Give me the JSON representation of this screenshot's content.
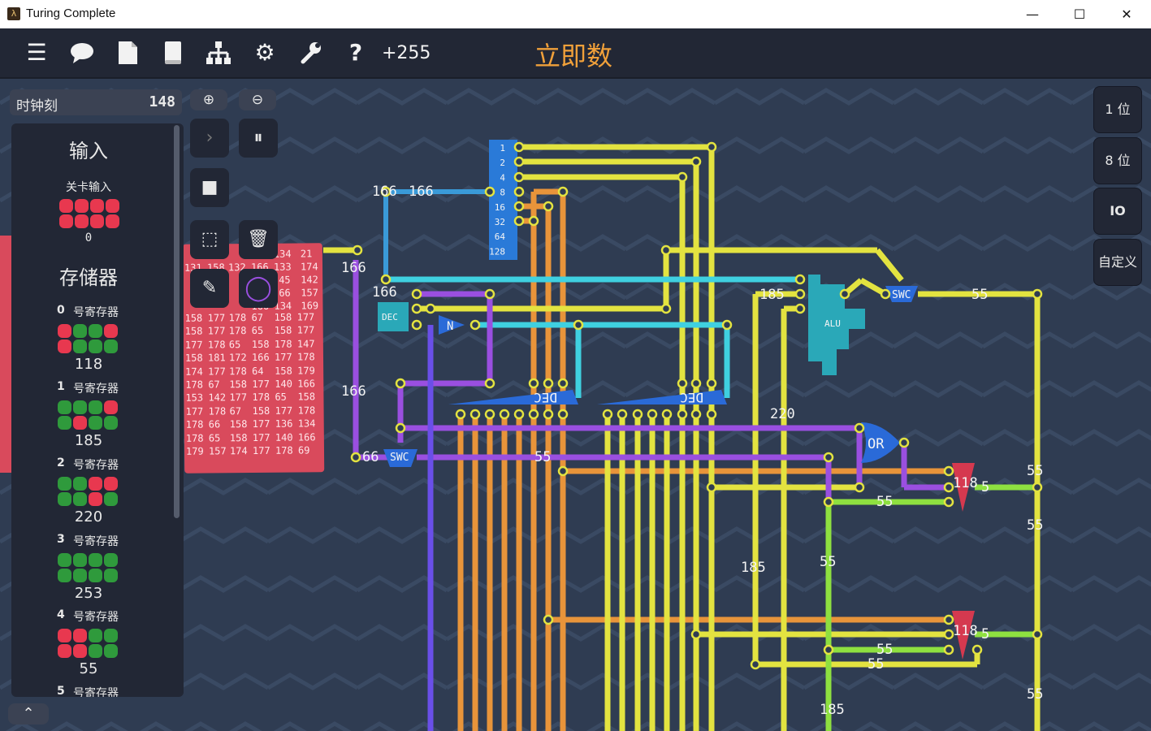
{
  "window": {
    "title": "Turing Complete",
    "controls": {
      "minimize": "—",
      "maximize": "☐",
      "close": "✕"
    }
  },
  "toolbar": {
    "icons": [
      "menu-icon",
      "chat-icon",
      "document-icon",
      "book-icon",
      "hierarchy-icon",
      "gear-icon",
      "wrench-icon",
      "help-icon"
    ],
    "glyphs": {
      "menu": "☰",
      "chat": "💬",
      "document": "📄",
      "book": "📘",
      "hierarchy": "⊞",
      "gear": "⚙",
      "wrench": "🔧",
      "help": "?"
    },
    "score": "+255",
    "level_title": "立即数"
  },
  "simulation": {
    "clock_label": "时钟刻",
    "clock_value": "148",
    "zoom_in": "⊕",
    "zoom_out": "⊖",
    "step": "›",
    "pause": "⏸",
    "stop": "■",
    "select": "⬚",
    "delete": "🗑",
    "pencil": "✎",
    "color": "◯"
  },
  "side_panel": {
    "input_title": "输入",
    "level_input_label": "关卡输入",
    "level_input_value": "0",
    "storage_title": "存储器",
    "registers": [
      {
        "index": "0",
        "name": "号寄存器",
        "value": "118"
      },
      {
        "index": "1",
        "name": "号寄存器",
        "value": "185"
      },
      {
        "index": "2",
        "name": "号寄存器",
        "value": "220"
      },
      {
        "index": "3",
        "name": "号寄存器",
        "value": "253"
      },
      {
        "index": "4",
        "name": "号寄存器",
        "value": "55"
      },
      {
        "index": "5",
        "name": "号寄存器",
        "value": ""
      }
    ],
    "collapse": "⌃"
  },
  "right_panel": {
    "bit1": "1 位",
    "bit8": "8 位",
    "io": "IO",
    "custom": "自定义"
  },
  "memory_rows": [
    [
      "158",
      "177",
      "178",
      "67",
      "158",
      "177"
    ],
    [
      "158",
      "177",
      "178",
      "65",
      "158",
      "177"
    ],
    [
      "177",
      "178",
      "65",
      "158",
      "178",
      "147"
    ],
    [
      "158",
      "181",
      "172",
      "166",
      "177",
      "178"
    ],
    [
      "174",
      "177",
      "178",
      "64",
      "158",
      "179"
    ],
    [
      "178",
      "67",
      "158",
      "177",
      "140",
      "166"
    ],
    [
      "153",
      "142",
      "177",
      "178",
      "65",
      "158"
    ],
    [
      "177",
      "178",
      "67",
      "158",
      "177",
      "178"
    ],
    [
      "178",
      "66",
      "158",
      "177",
      "136",
      "134"
    ],
    [
      "178",
      "65",
      "158",
      "177",
      "140",
      "166"
    ],
    [
      "179",
      "157",
      "174",
      "177",
      "178",
      "69"
    ]
  ],
  "memory_top_rows": [
    [
      "134",
      "21"
    ],
    [
      "131",
      "158",
      "132",
      "166",
      "133",
      "174"
    ],
    [
      "45",
      "142"
    ],
    [
      "66",
      "157"
    ],
    [
      "166",
      "134",
      "169"
    ]
  ],
  "circuit_labels": {
    "input_bits": [
      "1",
      "2",
      "4",
      "8",
      "16",
      "32",
      "64",
      "128"
    ],
    "dec": "DEC",
    "not": "N",
    "swc": "SWC",
    "alu": "ALU",
    "or": "OR",
    "wire_values": [
      "166",
      "166",
      "166",
      "166",
      "166",
      "185",
      "55",
      "220",
      "66",
      "55",
      "118",
      "5",
      "55",
      "55",
      "185",
      "55",
      "55",
      "118",
      "5",
      "55",
      "55",
      "185",
      "55"
    ]
  },
  "colors": {
    "background": "#2f3c52",
    "toolbar": "#222735",
    "accent": "#f0a03a",
    "bit_on": "#e8384f",
    "bit_off": "#2f9a3c",
    "yellow_wire": "#e3e340",
    "orange_wire": "#e8943a",
    "cyan_wire": "#3fd0e0",
    "purple_wire": "#9a4fe0",
    "green_wire": "#8ee040",
    "blue_wire": "#3a9ad8"
  }
}
